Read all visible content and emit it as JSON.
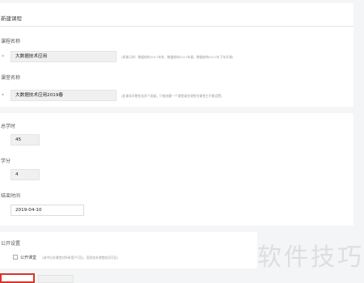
{
  "page_title": "新建课程",
  "course_name": {
    "label": "课程名称",
    "value": "大数据技术应用",
    "hint": "(如课示例：数据结构2017年秋、数据结构2017年春、数据结构2017年下年开课)"
  },
  "class_name": {
    "label": "课堂名称",
    "value": "大数据技术应用2019春",
    "hint": "(此课本学期包含多个班级，只能创建一个课堂或在课堂内课堂主不能设置)"
  },
  "total_hours": {
    "label": "总学时",
    "value": "45"
  },
  "credits": {
    "label": "学分",
    "value": "4"
  },
  "end_time": {
    "label": "结束时间",
    "value": "2019-04-10"
  },
  "public_settings": {
    "title": "公开设置",
    "checkbox_label": "公开课堂",
    "checkbox_hint": "(选中后本课堂对所有用户可见，否则仅本课堂成员可见)",
    "checked": false
  },
  "watermark": "软件技巧",
  "colors": {
    "highlight": "#d9342b",
    "page_bg": "#f4f5f7"
  }
}
